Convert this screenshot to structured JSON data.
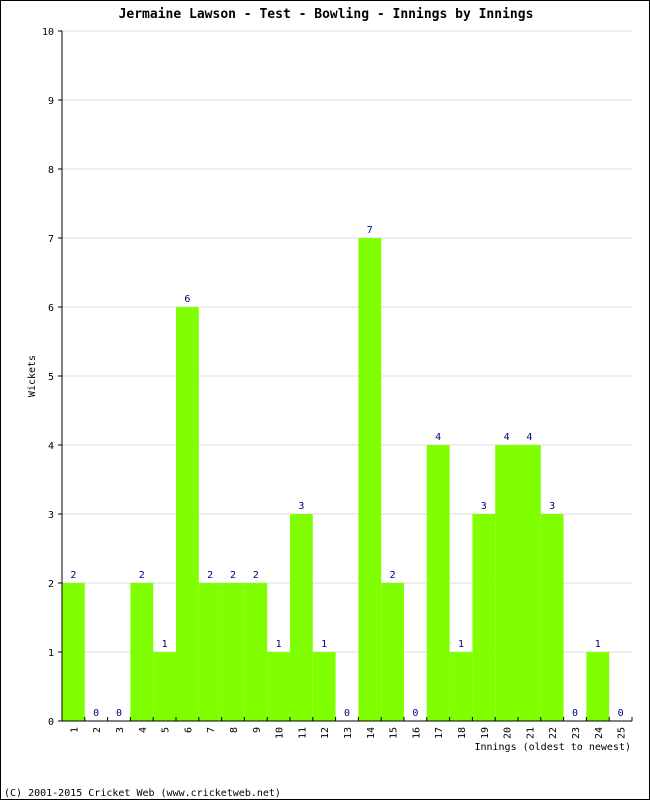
{
  "chart_data": {
    "type": "bar",
    "title": "Jermaine Lawson - Test - Bowling - Innings by Innings",
    "xlabel": "Innings (oldest to newest)",
    "ylabel": "Wickets",
    "ylim": [
      0,
      10
    ],
    "yticks": [
      0,
      1,
      2,
      3,
      4,
      5,
      6,
      7,
      8,
      9,
      10
    ],
    "grid": true,
    "categories": [
      "1",
      "2",
      "3",
      "4",
      "5",
      "6",
      "7",
      "8",
      "9",
      "10",
      "11",
      "12",
      "13",
      "14",
      "15",
      "16",
      "17",
      "18",
      "19",
      "20",
      "21",
      "22",
      "23",
      "24",
      "25"
    ],
    "values": [
      2,
      0,
      0,
      2,
      1,
      6,
      2,
      2,
      2,
      1,
      3,
      1,
      0,
      7,
      2,
      0,
      4,
      1,
      3,
      4,
      4,
      3,
      0,
      1,
      0
    ],
    "bar_color": "#80ff00",
    "label_color": "#000080"
  },
  "footer": "(C) 2001-2015 Cricket Web (www.cricketweb.net)"
}
